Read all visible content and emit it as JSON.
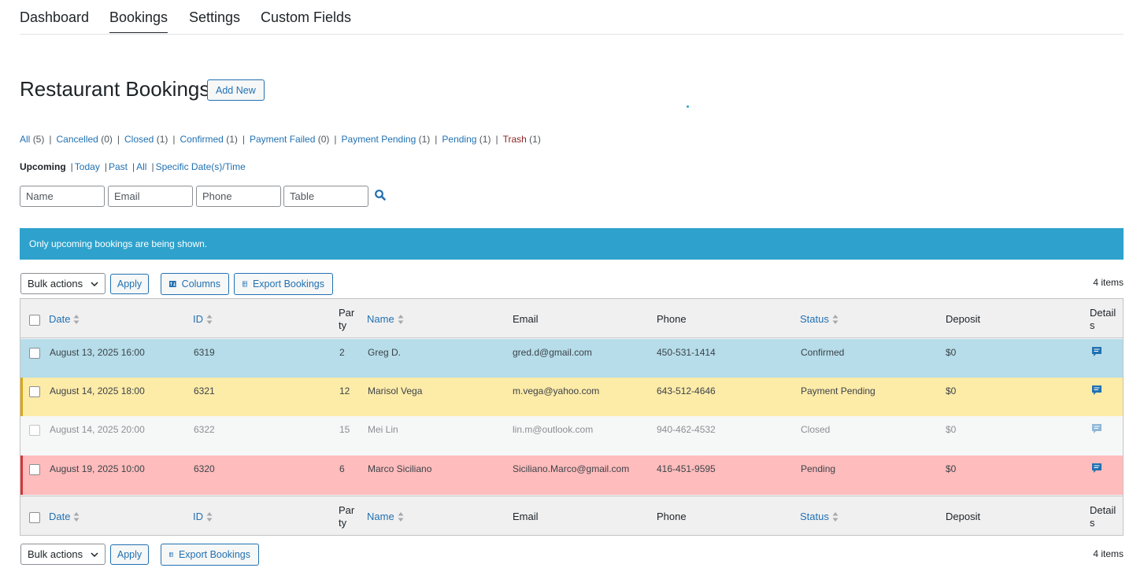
{
  "nav": {
    "tabs": [
      {
        "label": "Dashboard"
      },
      {
        "label": "Bookings"
      },
      {
        "label": "Settings"
      },
      {
        "label": "Custom Fields"
      }
    ]
  },
  "page": {
    "title": "Restaurant Bookings",
    "add_new_label": "Add New"
  },
  "views": {
    "all": {
      "label": "All",
      "count": "(5)"
    },
    "cancelled": {
      "label": "Cancelled",
      "count": "(0)"
    },
    "closed": {
      "label": "Closed",
      "count": "(1)"
    },
    "confirmed": {
      "label": "Confirmed",
      "count": "(1)"
    },
    "payment_failed": {
      "label": "Payment Failed",
      "count": "(0)"
    },
    "payment_pending": {
      "label": "Payment Pending",
      "count": "(1)"
    },
    "pending": {
      "label": "Pending",
      "count": "(1)"
    },
    "trash": {
      "label": "Trash",
      "count": "(1)"
    }
  },
  "date_filters": {
    "current": "Upcoming",
    "today": "Today",
    "past": "Past",
    "all": "All",
    "specific": "Specific Date(s)/Time"
  },
  "filters": {
    "name_placeholder": "Name",
    "email_placeholder": "Email",
    "phone_placeholder": "Phone",
    "table_placeholder": "Table"
  },
  "notice": "Only upcoming bookings are being shown.",
  "toolbar": {
    "bulk_label": "Bulk actions",
    "apply_label": "Apply",
    "columns_label": "Columns",
    "export_label": "Export Bookings",
    "items_count": "4 items"
  },
  "columns": {
    "date": "Date",
    "id": "ID",
    "party_1": "Par",
    "party_2": "ty",
    "name": "Name",
    "email": "Email",
    "phone": "Phone",
    "status": "Status",
    "deposit": "Deposit",
    "details_1": "Detail",
    "details_2": "s"
  },
  "bookings": [
    {
      "date": "August 13, 2025 16:00",
      "id": "6319",
      "party": "2",
      "name": "Greg D.",
      "email": "gred.d@gmail.com",
      "phone": "450-531-1414",
      "status": "Confirmed",
      "deposit": "$0"
    },
    {
      "date": "August 14, 2025 18:00",
      "id": "6321",
      "party": "12",
      "name": "Marisol Vega",
      "email": "m.vega@yahoo.com",
      "phone": "643-512-4646",
      "status": "Payment Pending",
      "deposit": "$0"
    },
    {
      "date": "August 14, 2025 20:00",
      "id": "6322",
      "party": "15",
      "name": "Mei Lin",
      "email": "lin.m@outlook.com",
      "phone": "940-462-4532",
      "status": "Closed",
      "deposit": "$0"
    },
    {
      "date": "August 19, 2025 10:00",
      "id": "6320",
      "party": "6",
      "name": "Marco Siciliano",
      "email": "Siciliano.Marco@gmail.com",
      "phone": "416-451-9595",
      "status": "Pending",
      "deposit": "$0"
    }
  ],
  "colors": {
    "link": "#2271b1",
    "notice": "#2ea2cc",
    "confirmed_row": "#b6dde9",
    "payment_pending_row": "#fdeba8",
    "closed_row": "#f6f7f7",
    "pending_row": "#ffbcbc"
  },
  "icons": {
    "search": "search-icon",
    "columns": "columns-icon",
    "export": "spreadsheet-icon",
    "details": "comment-icon"
  }
}
